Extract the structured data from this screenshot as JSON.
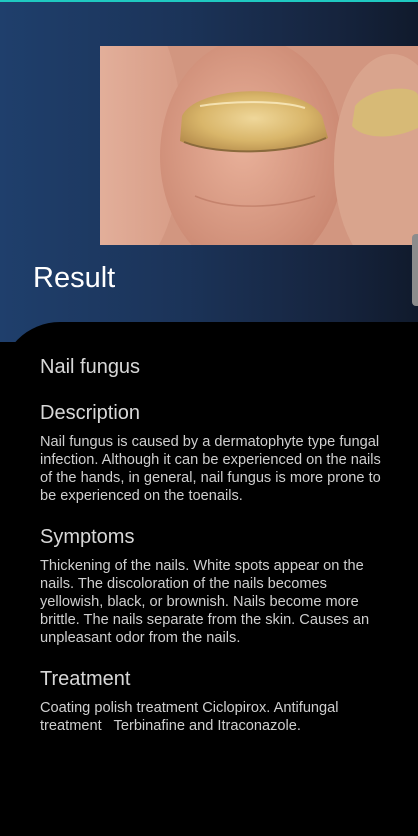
{
  "result": {
    "title": "Result"
  },
  "diagnosis": {
    "name": "Nail fungus",
    "description": {
      "heading": "Description",
      "text": "Nail fungus is caused by a dermatophyte type fungal infection. Although it can be experienced on the nails of the hands, in general, nail fungus is more prone to be experienced on the toenails."
    },
    "symptoms": {
      "heading": "Symptoms",
      "text": "Thickening of the nails. White spots appear on the nails. The discoloration of the nails becomes yellowish, black, or brownish. Nails become more brittle. The nails separate from the skin. Causes an unpleasant odor from the nails."
    },
    "treatment": {
      "heading": "Treatment",
      "text": "Coating polish treatment Ciclopirox. Antifungal treatment   Terbinafine and Itraconazole."
    }
  },
  "colors": {
    "accent": "#1fc9c1",
    "header_gradient_start": "#1f3f6c",
    "header_gradient_end": "#101a2c",
    "panel": "#000000"
  }
}
